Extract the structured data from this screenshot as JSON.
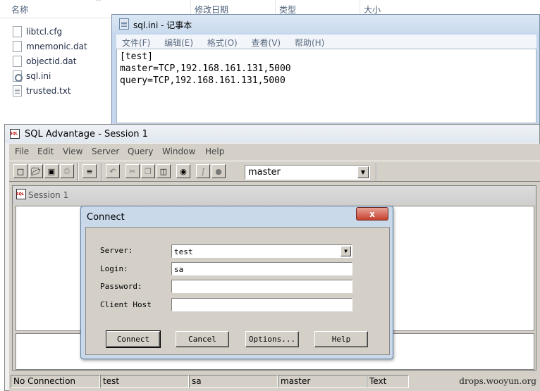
{
  "explorer": {
    "columns": [
      "名称",
      "修改日期",
      "类型",
      "大小"
    ],
    "files": [
      {
        "name": "libtcl.cfg",
        "icon": "file-icon"
      },
      {
        "name": "mnemonic.dat",
        "icon": "file-icon"
      },
      {
        "name": "objectid.dat",
        "icon": "file-icon"
      },
      {
        "name": "sql.ini",
        "icon": "config-file-icon"
      },
      {
        "name": "trusted.txt",
        "icon": "text-file-icon"
      }
    ]
  },
  "notepad": {
    "title": "sql.ini - 记事本",
    "menu": [
      "文件(F)",
      "编辑(E)",
      "格式(O)",
      "查看(V)",
      "帮助(H)"
    ],
    "lines": [
      "[test]",
      "master=TCP,192.168.161.131,5000",
      "query=TCP,192.168.161.131,5000"
    ]
  },
  "sql_advantage": {
    "title": "SQL Advantage - Session 1",
    "menu": [
      "File",
      "Edit",
      "View",
      "Server",
      "Query",
      "Window",
      "Help"
    ],
    "database": "master",
    "session_title": "Session 1",
    "status": [
      "No Connection",
      "test",
      "sa",
      "master",
      "Text"
    ]
  },
  "connect_dialog": {
    "title": "Connect",
    "close_label": "x",
    "fields": {
      "server": {
        "label": "Server:",
        "value": "test"
      },
      "login": {
        "label": "Login:",
        "value": "sa"
      },
      "password": {
        "label": "Password:",
        "value": ""
      },
      "client_host": {
        "label": "Client Host",
        "value": ""
      }
    },
    "buttons": {
      "connect": "Connect",
      "cancel": "Cancel",
      "options": "Options...",
      "help": "Help"
    }
  },
  "watermark": "drops.wooyun.org"
}
